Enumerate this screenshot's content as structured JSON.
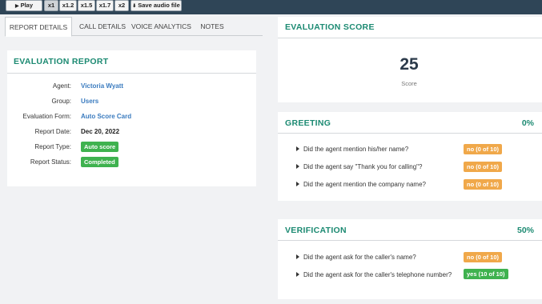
{
  "player": {
    "play_label": "Play",
    "speeds": [
      "x1",
      "x1.2",
      "x1.5",
      "x1.7",
      "x2"
    ],
    "selected_speed": "x1",
    "save_label": "Save audio file"
  },
  "tabs": [
    "REPORT DETAILS",
    "CALL DETAILS",
    "VOICE ANALYTICS",
    "NOTES"
  ],
  "active_tab": "REPORT DETAILS",
  "report": {
    "title": "EVALUATION REPORT",
    "agent_label": "Agent:",
    "agent": "Victoria Wyatt",
    "group_label": "Group:",
    "group": "Users",
    "form_label": "Evaluation Form:",
    "form": "Auto Score Card",
    "date_label": "Report Date:",
    "date": "Dec 20, 2022",
    "type_label": "Report Type:",
    "type": "Auto score",
    "status_label": "Report Status:",
    "status": "Completed"
  },
  "score": {
    "title": "EVALUATION SCORE",
    "value": "25",
    "caption": "Score"
  },
  "greeting": {
    "title": "GREETING",
    "percent": "0%",
    "questions": [
      {
        "text": "Did the agent mention his/her name?",
        "answer": "no (0 of 10)",
        "status": "no"
      },
      {
        "text": "Did the agent say \"Thank you for calling\"?",
        "answer": "no (0 of 10)",
        "status": "no"
      },
      {
        "text": "Did the agent mention the company name?",
        "answer": "no (0 of 10)",
        "status": "no"
      }
    ]
  },
  "verification": {
    "title": "VERIFICATION",
    "percent": "50%",
    "questions": [
      {
        "text": "Did the agent ask for the caller's name?",
        "answer": "no (0 of 10)",
        "status": "no"
      },
      {
        "text": "Did the agent ask for the caller's telephone number?",
        "answer": "yes (10 of 10)",
        "status": "yes"
      }
    ]
  },
  "colors": {
    "accent": "#1c8a72",
    "link": "#3a7bbf",
    "yes": "#3fb24f",
    "no": "#f0a84a",
    "topbar": "#2f4557"
  }
}
